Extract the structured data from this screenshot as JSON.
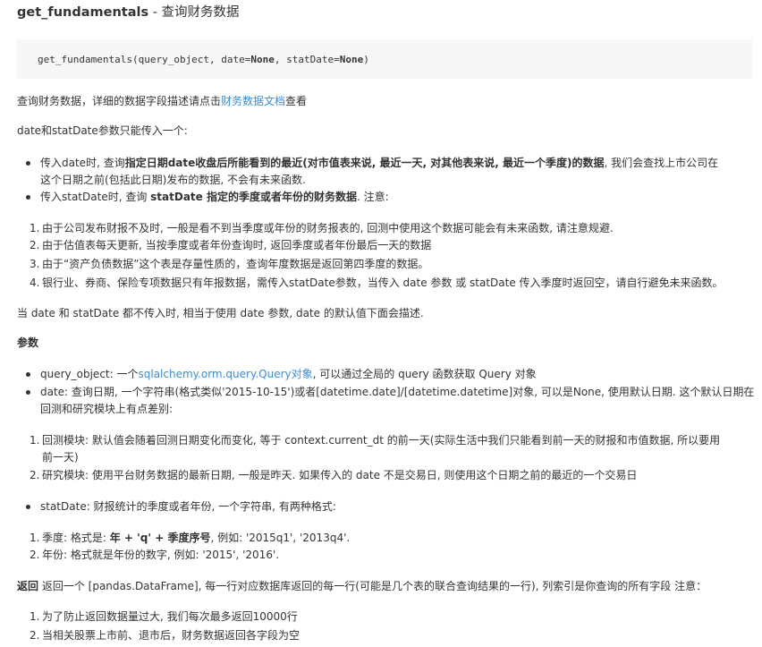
{
  "title": {
    "fn": "get_fundamentals",
    "rest": " - 查询财务数据"
  },
  "code": {
    "signature_start": "get_fundamentals(query_object, date=",
    "none1": "None",
    "mid": ", statDate=",
    "none2": "None",
    "end": ")"
  },
  "intro": {
    "before": "查询财务数据，详细的数据字段描述请点击",
    "link": "财务数据文档",
    "after": "查看"
  },
  "note_one": "date和statDate参数只能传入一个:",
  "bullets1": [
    {
      "a": "传入date时, 查询",
      "b": "指定日期date收盘后所能看到的最近(对市值表来说, 最近一天, 对其他表来说, 最近一个季度)的数据",
      "c": ", 我们会查找上市公司在",
      "line2": "这个日期之前(包括此日期)发布的数据, 不会有未来函数."
    },
    {
      "a": "传入statDate时, 查询 ",
      "b": "statDate 指定的季度或者年份的财务数据",
      "c": ". 注意:"
    }
  ],
  "ol1": [
    "由于公司发布财报不及时, 一般是看不到当季度或年份的财务报表的, 回测中使用这个数据可能会有未来函数, 请注意规避.",
    "由于估值表每天更新, 当按季度或者年份查询时, 返回季度或者年份最后一天的数据",
    "由于“资产负债数据”这个表是存量性质的，查询年度数据是返回第四季度的数据。",
    "银行业、券商、保险专项数据只有年报数据，需传入statDate参数，当传入 date 参数 或 statDate 传入季度时返回空，请自行避免未来函数。"
  ],
  "note_two": "当 date 和 statDate 都不传入时, 相当于使用 date 参数, date 的默认值下面会描述.",
  "params_heading": "参数",
  "param_qo": {
    "a": "query_object: 一个",
    "link": "sqlalchemy.orm.query.Query对象",
    "c": ", 可以通过全局的 query 函数获取 Query 对象"
  },
  "param_date": {
    "line1": "date: 查询日期, 一个字符串(格式类似'2015-10-15')或者[datetime.date]/[datetime.datetime]对象, 可以是None, 使用默认日期. 这个默认日期在",
    "line2": "回测和研究模块上有点差别:"
  },
  "ol2": [
    {
      "line1": "回测模块: 默认值会随着回测日期变化而变化, 等于 context.current_dt 的前一天(实际生活中我们只能看到前一天的财报和市值数据, 所以要用",
      "line2": "前一天)"
    },
    {
      "line1": "研究模块: 使用平台财务数据的最新日期, 一般是昨天. 如果传入的 date 不是交易日, 则使用这个日期之前的最近的一个交易日"
    }
  ],
  "param_statdate": "statDate: 财报统计的季度或者年份, 一个字符串, 有两种格式:",
  "ol3": [
    {
      "a": "季度: 格式是: ",
      "b": "年 + 'q' + 季度序号",
      "c": ", 例如: '2015q1', '2013q4'."
    },
    {
      "a": "年份: 格式就是年份的数字, 例如: '2015', '2016'."
    }
  ],
  "returns": {
    "label": "返回",
    "text": " 返回一个 [pandas.DataFrame], 每一行对应数据库返回的每一行(可能是几个表的联合查询结果的一行), 列索引是你查询的所有字段 注意："
  },
  "ol4": [
    "为了防止返回数据量过大, 我们每次最多返回10000行",
    "当相关股票上市前、退市后，财务数据返回各字段为空"
  ],
  "numbers": [
    "1.",
    "2.",
    "3.",
    "4."
  ]
}
